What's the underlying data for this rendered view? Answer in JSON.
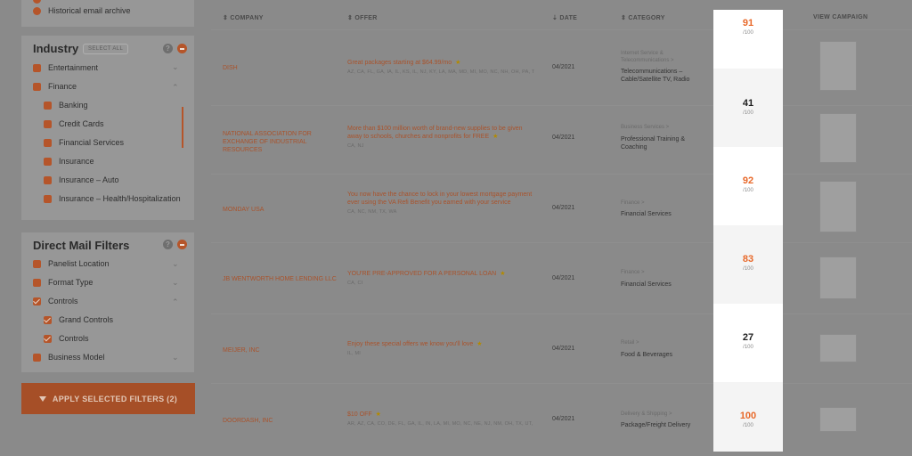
{
  "sidebar": {
    "top_item": "Historical email archive",
    "industry": {
      "title": "Industry",
      "select_all": "SELECT ALL",
      "help": "?",
      "items": [
        {
          "label": "Entertainment",
          "chevron": "⌄"
        },
        {
          "label": "Finance",
          "chevron": "⌃"
        }
      ],
      "sub_items": [
        "Banking",
        "Credit Cards",
        "Financial Services",
        "Insurance",
        "Insurance – Auto",
        "Insurance – Health/Hospitalization"
      ]
    },
    "direct_mail": {
      "title": "Direct Mail Filters",
      "help": "?",
      "items": [
        {
          "label": "Panelist Location",
          "chevron": "⌄"
        },
        {
          "label": "Format Type",
          "chevron": "⌄"
        },
        {
          "label": "Controls",
          "chevron": "⌃"
        }
      ],
      "sub_items": [
        "Grand Controls",
        "Controls"
      ],
      "last_item": {
        "label": "Business Model",
        "chevron": "⌄"
      }
    },
    "apply_button": "APPLY SELECTED FILTERS (2)"
  },
  "table": {
    "headers": {
      "company": "⇕ COMPANY",
      "offer": "⇕ OFFER",
      "date": "⇣ DATE",
      "category": "⇕ CATEGORY",
      "campaign": "VIEW CAMPAIGN"
    },
    "score_suffix": "/100",
    "rows": [
      {
        "company": "DISH",
        "offer": "Great packages starting at $64.99/mo",
        "states": "AZ, CA, FL, GA, IA, IL, KS, IL, NJ, KY, LA, MA, MD, MI, MO, NC, NH, OH, PA, TX, VA, WI",
        "date": "04/2021",
        "category_parent": "Internet Service & Telecommunications >",
        "category": "Telecommunications – Cable/Satellite TV, Radio",
        "score": "91"
      },
      {
        "company": "NATIONAL ASSOCIATION FOR EXCHANGE OF INDUSTRIAL RESOURCES",
        "offer": "More than $100 million worth of brand-new supplies to be given away to schools, churches and nonprofits for FREE",
        "states": "CA, NJ",
        "date": "04/2021",
        "category_parent": "Business Services >",
        "category": "Professional Training & Coaching",
        "score": "41"
      },
      {
        "company": "MONDAY USA",
        "offer": "You now have the chance to lock in your lowest mortgage payment ever using the VA Refi Benefit you earned with your service",
        "states": "CA, NC, NM, TX, WA",
        "date": "04/2021",
        "category_parent": "Finance >",
        "category": "Financial Services",
        "score": "92"
      },
      {
        "company": "JB WENTWORTH HOME LENDING LLC",
        "offer": "YOU'RE PRE-APPROVED FOR A PERSONAL LOAN",
        "states": "CA, CI",
        "date": "04/2021",
        "category_parent": "Finance >",
        "category": "Financial Services",
        "score": "83"
      },
      {
        "company": "MEIJER, INC",
        "offer": "Enjoy these special offers we know you'll love",
        "states": "IL, MI",
        "date": "04/2021",
        "category_parent": "Retail >",
        "category": "Food & Beverages",
        "score": "27"
      },
      {
        "company": "DOORDASH, INC",
        "offer": "$10 OFF",
        "states": "AR, AZ, CA, CO, DE, FL, GA, IL, IN, LA, MI, MO, NC, NE, NJ, NM, OH, TX, UT, VA, WI",
        "date": "04/2021",
        "category_parent": "Delivery & Shipping >",
        "category": "Package/Freight Delivery",
        "score": "100"
      }
    ]
  },
  "colors": {
    "accent": "#e8692a",
    "dimmed_accent": "#a9532c",
    "overlay": "#8a8a8a"
  }
}
